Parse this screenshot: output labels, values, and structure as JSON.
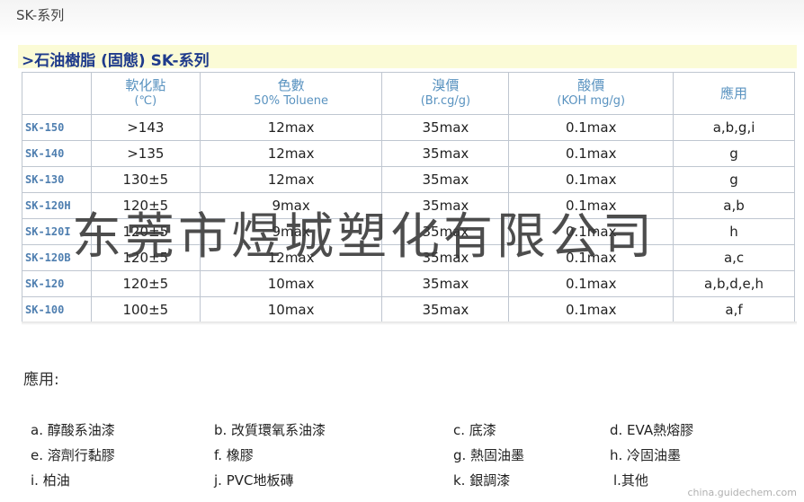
{
  "page_label": "SK-系列",
  "title": ">石油樹脂 (固態) SK-系列",
  "table": {
    "headers": [
      {
        "main": "",
        "sub": ""
      },
      {
        "main": "軟化點",
        "sub": "(℃)"
      },
      {
        "main": "色數",
        "sub": "50% Toluene"
      },
      {
        "main": "溴價",
        "sub": "(Br.cg/g)"
      },
      {
        "main": "酸價",
        "sub": "(KOH mg/g)"
      },
      {
        "main": "應用",
        "sub": ""
      }
    ],
    "rows": [
      [
        "SK-150",
        ">143",
        "12max",
        "35max",
        "0.1max",
        "a,b,g,i"
      ],
      [
        "SK-140",
        ">135",
        "12max",
        "35max",
        "0.1max",
        "g"
      ],
      [
        "SK-130",
        "130±5",
        "12max",
        "35max",
        "0.1max",
        "g"
      ],
      [
        "SK-120H",
        "120±5",
        "9max",
        "35max",
        "0.1max",
        "a,b"
      ],
      [
        "SK-120I",
        "120±5",
        "9max",
        "35max",
        "0.1max",
        "h"
      ],
      [
        "SK-120B",
        "120±5",
        "12max",
        "35max",
        "0.1max",
        "a,c"
      ],
      [
        "SK-120",
        "120±5",
        "10max",
        "35max",
        "0.1max",
        "a,b,d,e,h"
      ],
      [
        "SK-100",
        "100±5",
        "10max",
        "35max",
        "0.1max",
        "a,f"
      ]
    ]
  },
  "watermark": "东莞市煜城塑化有限公司",
  "applications": {
    "heading": "應用:",
    "items": [
      "a. 醇酸系油漆",
      "b. 改質環氧系油漆",
      "c. 底漆",
      "d. EVA熱熔膠",
      "e. 溶劑行黏膠",
      "f. 橡膠",
      "g. 熱固油墨",
      "h. 冷固油墨",
      "i. 柏油",
      "j. PVC地板磚",
      "k. 銀調漆",
      "l.其他"
    ]
  },
  "site_mark": "china.guidechem.com"
}
